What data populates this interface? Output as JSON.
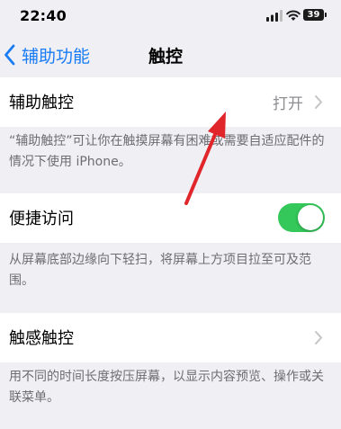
{
  "status_bar": {
    "time": "22:40",
    "battery_level": "39",
    "icons": [
      "signal-icon",
      "wifi-icon",
      "battery-icon"
    ]
  },
  "nav": {
    "back_label": "辅助功能",
    "title": "触控",
    "back_icon": "chevron-back-icon"
  },
  "assistive_touch": {
    "label": "辅助触控",
    "value": "打开"
  },
  "assistive_touch_footer": "“辅助触控”可让你在触摸屏幕有困难或需要自适应配件的情况下使用 iPhone。",
  "reachability": {
    "label": "便捷访问",
    "toggle_on": true
  },
  "reachability_footer": "从屏幕底部边缘向下轻扫，将屏幕上方项目拉至可及范围。",
  "haptic_touch": {
    "label": "触感触控"
  },
  "haptic_touch_footer": "用不同的时间长度按压屏幕，以显示内容预览、操作或关联菜单。",
  "colors": {
    "accent": "#1a7cf5",
    "toggle_on": "#34c759",
    "annotation_arrow": "#e0262a",
    "background": "#efeff4"
  }
}
